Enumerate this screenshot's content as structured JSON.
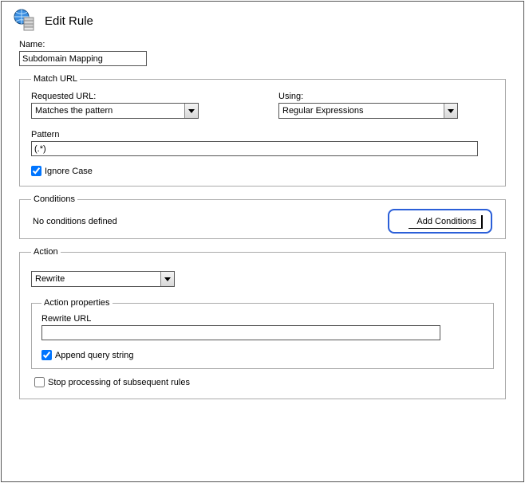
{
  "header": {
    "title": "Edit Rule"
  },
  "name": {
    "label": "Name:",
    "value": "Subdomain Mapping"
  },
  "matchUrl": {
    "legend": "Match URL",
    "requestedUrl": {
      "label": "Requested URL:",
      "value": "Matches the pattern"
    },
    "using": {
      "label": "Using:",
      "value": "Regular Expressions"
    },
    "pattern": {
      "label": "Pattern",
      "value": "(.*)"
    },
    "ignoreCase": {
      "label": "Ignore Case",
      "checked": true
    }
  },
  "conditions": {
    "legend": "Conditions",
    "emptyText": "No conditions defined",
    "addButton": "Add Conditions"
  },
  "action": {
    "legend": "Action",
    "type": {
      "value": "Rewrite"
    },
    "props": {
      "legend": "Action properties",
      "rewriteUrl": {
        "label": "Rewrite URL",
        "value": ""
      },
      "appendQueryString": {
        "label": "Append query string",
        "checked": true
      }
    },
    "stopProcessing": {
      "label": "Stop processing of subsequent rules",
      "checked": false
    }
  }
}
